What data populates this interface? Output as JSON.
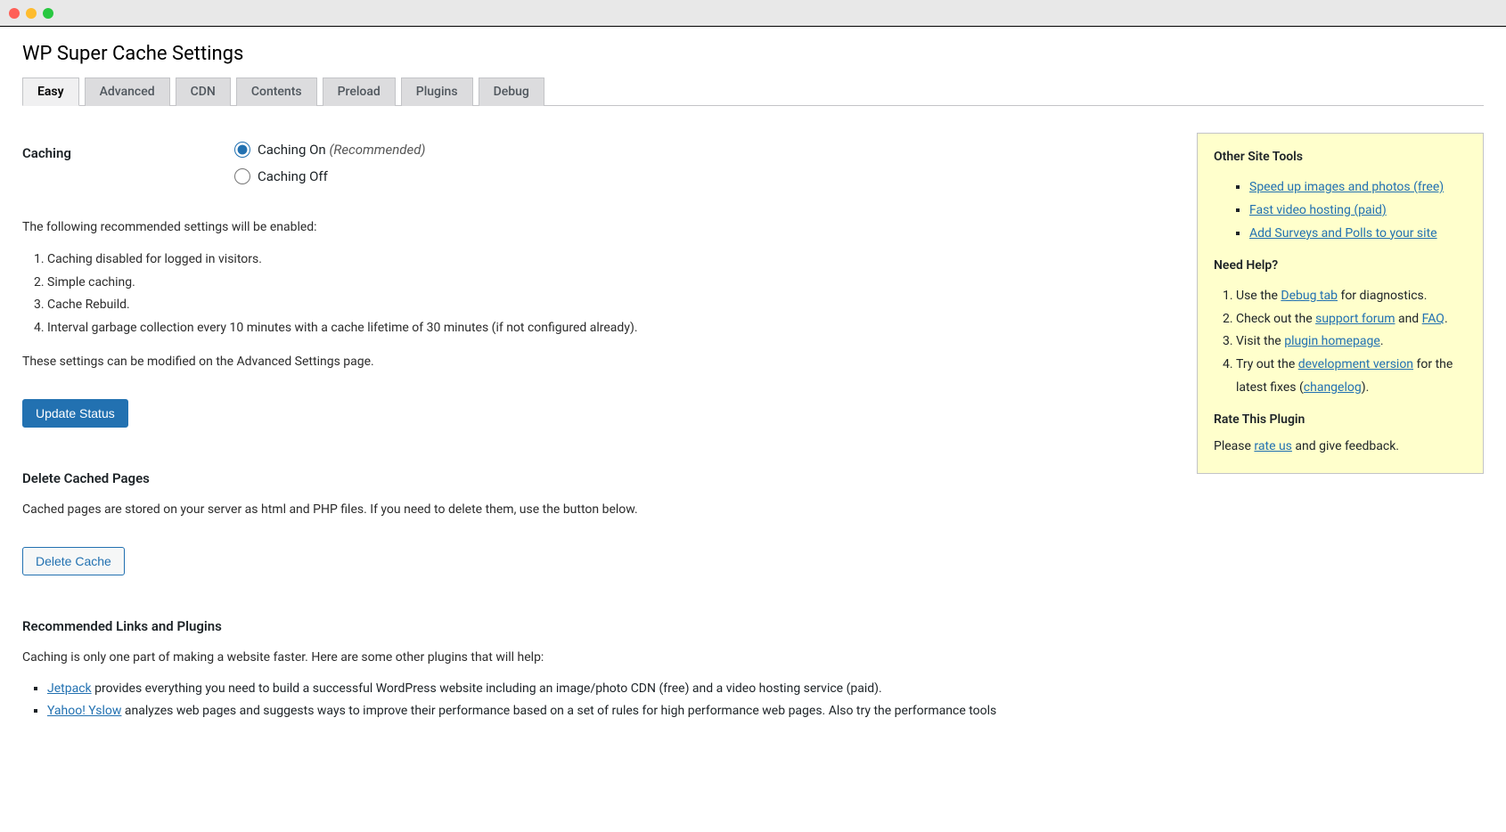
{
  "page": {
    "title": "WP Super Cache Settings"
  },
  "tabs": [
    {
      "label": "Easy",
      "active": true
    },
    {
      "label": "Advanced",
      "active": false
    },
    {
      "label": "CDN",
      "active": false
    },
    {
      "label": "Contents",
      "active": false
    },
    {
      "label": "Preload",
      "active": false
    },
    {
      "label": "Plugins",
      "active": false
    },
    {
      "label": "Debug",
      "active": false
    }
  ],
  "caching": {
    "label": "Caching",
    "options": {
      "on_label": "Caching On ",
      "on_suffix": "(Recommended)",
      "off_label": "Caching Off"
    }
  },
  "desc": {
    "intro": "The following recommended settings will be enabled:",
    "items": [
      "Caching disabled for logged in visitors.",
      "Simple caching.",
      "Cache Rebuild.",
      "Interval garbage collection every 10 minutes with a cache lifetime of 30 minutes (if not configured already)."
    ],
    "outro": "These settings can be modified on the Advanced Settings page."
  },
  "buttons": {
    "update_status": "Update Status",
    "delete_cache": "Delete Cache"
  },
  "delete_section": {
    "heading": "Delete Cached Pages",
    "body": "Cached pages are stored on your server as html and PHP files. If you need to delete them, use the button below."
  },
  "recommended": {
    "heading": "Recommended Links and Plugins",
    "body": "Caching is only one part of making a website faster. Here are some other plugins that will help:",
    "items": [
      {
        "link": "Jetpack",
        "rest": " provides everything you need to build a successful WordPress website including an image/photo CDN (free) and a video hosting service (paid)."
      },
      {
        "link": "Yahoo! Yslow",
        "rest": " analyzes web pages and suggests ways to improve their performance based on a set of rules for high performance web pages. Also try the performance tools"
      }
    ]
  },
  "sidebar": {
    "tools_heading": "Other Site Tools",
    "tools": [
      "Speed up images and photos (free)",
      "Fast video hosting (paid)",
      "Add Surveys and Polls to your site"
    ],
    "help_heading": "Need Help?",
    "help_items": {
      "i1_pre": "Use the ",
      "i1_link": "Debug tab",
      "i1_post": " for diagnostics.",
      "i2_pre": "Check out the ",
      "i2_link1": "support forum",
      "i2_mid": " and ",
      "i2_link2": "FAQ",
      "i2_post": ".",
      "i3_pre": "Visit the ",
      "i3_link": "plugin homepage",
      "i3_post": ".",
      "i4_pre": "Try out the ",
      "i4_link1": "development version",
      "i4_mid": " for the latest fixes (",
      "i4_link2": "changelog",
      "i4_post": ")."
    },
    "rate_heading": "Rate This Plugin",
    "rate_pre": "Please ",
    "rate_link": "rate us",
    "rate_post": " and give feedback."
  }
}
